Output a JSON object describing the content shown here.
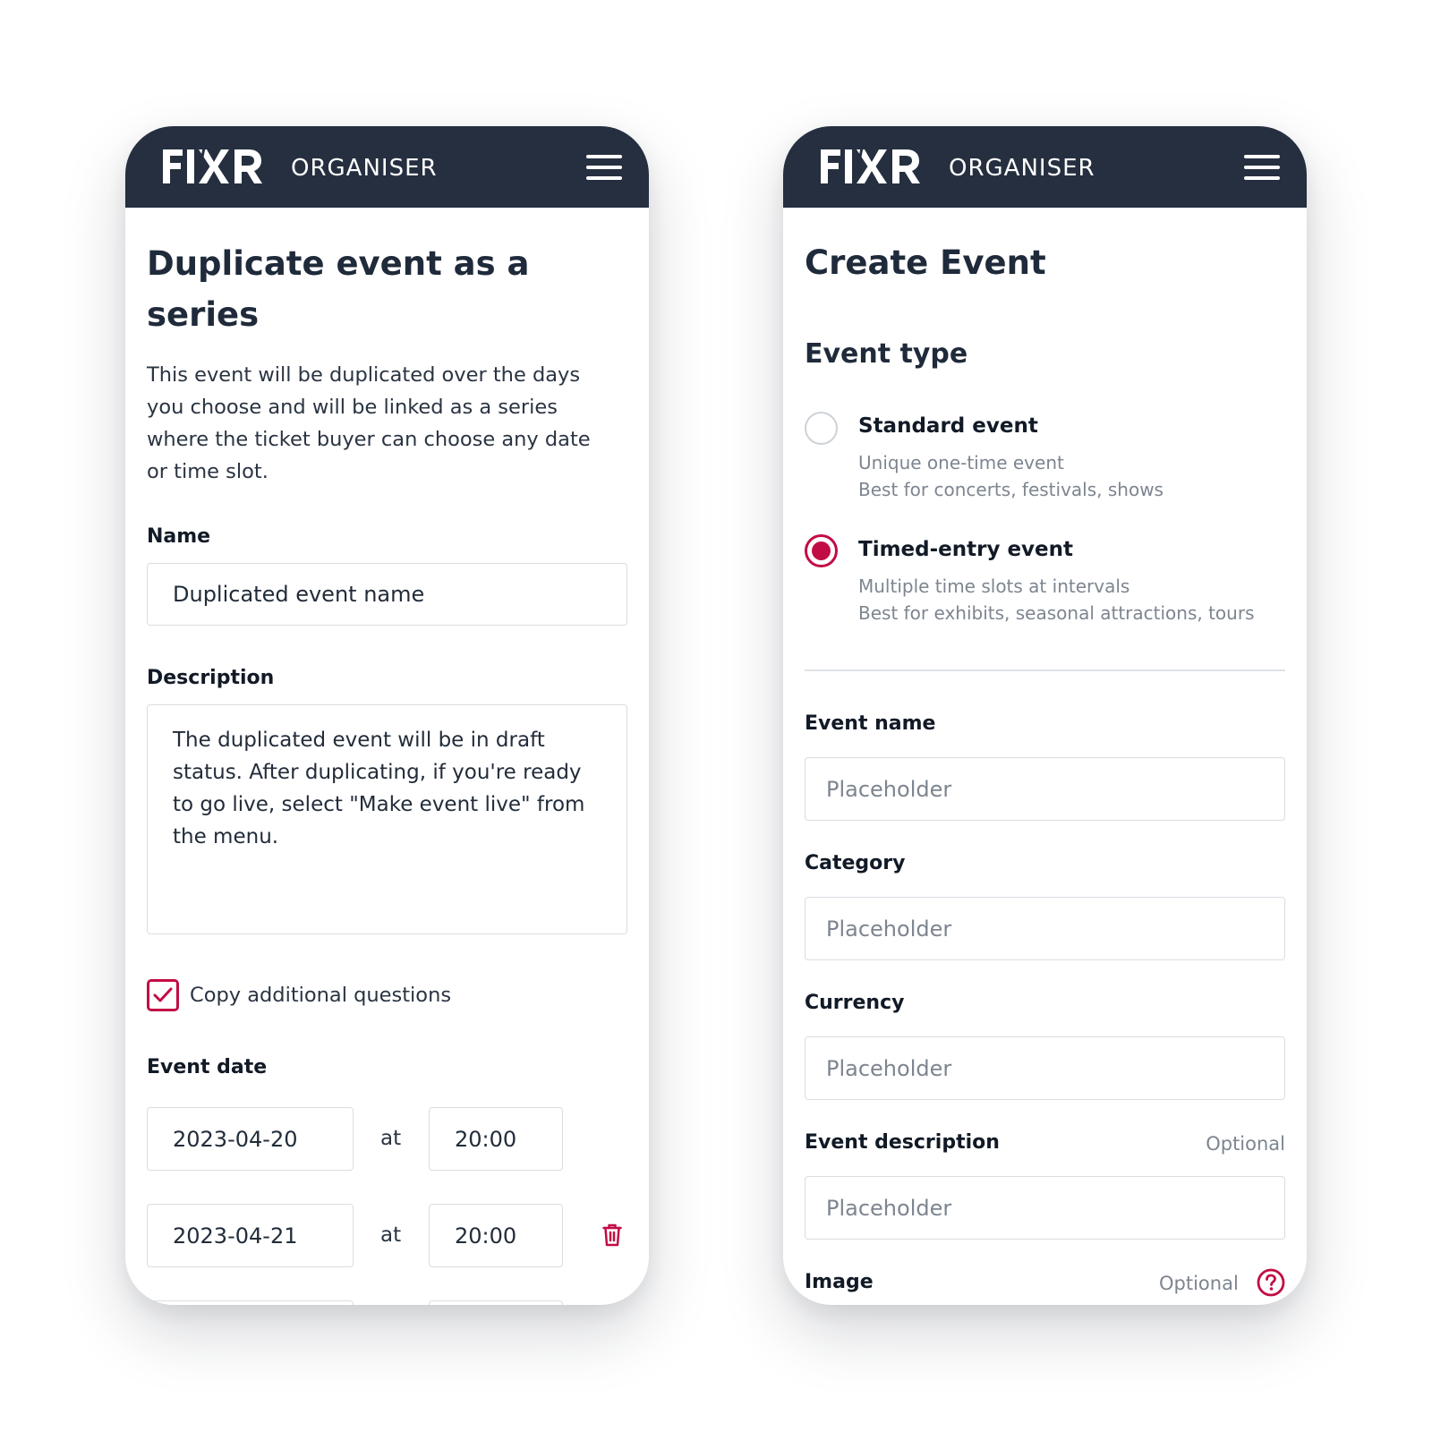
{
  "colors": {
    "header_bg": "#252f3f",
    "accent": "#c20d44",
    "page_bg": "#ffffff"
  },
  "left": {
    "header": {
      "logo_text": "FIXR",
      "brand": "ORGANISER",
      "menu_icon": "hamburger-menu-icon"
    },
    "title_line1": "Duplicate event as a",
    "title_line2": "series",
    "intro_lines": [
      "This event will be duplicated over the days",
      "you choose and will be linked as a series",
      "where the ticket buyer can choose any date",
      "or time slot."
    ],
    "name_label": "Name",
    "name_value": "Duplicated event name",
    "description_label": "Description",
    "description_lines": [
      "The duplicated event will be in draft",
      "status. After duplicating, if you're ready",
      "to go live, select \"Make event live\" from",
      "the menu."
    ],
    "copy_questions": {
      "label": "Copy additional questions",
      "checked": true
    },
    "event_date_label": "Event date",
    "at_label": "at",
    "dates": [
      {
        "date": "2023-04-20",
        "time": "20:00"
      },
      {
        "date": "2023-04-21",
        "time": "20:00"
      }
    ],
    "delete_icon": "trash-icon"
  },
  "right": {
    "header": {
      "logo_text": "FIXR",
      "brand": "ORGANISER",
      "menu_icon": "hamburger-menu-icon"
    },
    "title": "Create Event",
    "event_type_heading": "Event type",
    "options": [
      {
        "title": "Standard event",
        "line1": "Unique one-time event",
        "line2": "Best for concerts, festivals, shows",
        "selected": false
      },
      {
        "title": "Timed-entry event",
        "line1": "Multiple time slots at intervals",
        "line2": "Best for exhibits, seasonal attractions, tours",
        "selected": true
      }
    ],
    "fields": {
      "event_name": {
        "label": "Event name",
        "placeholder": "Placeholder"
      },
      "category": {
        "label": "Category",
        "placeholder": "Placeholder"
      },
      "currency": {
        "label": "Currency",
        "placeholder": "Placeholder"
      },
      "event_description": {
        "label": "Event description",
        "optional": "Optional",
        "placeholder": "Placeholder"
      },
      "image": {
        "label": "Image",
        "optional": "Optional",
        "help_icon": "help-circle-icon"
      }
    }
  }
}
